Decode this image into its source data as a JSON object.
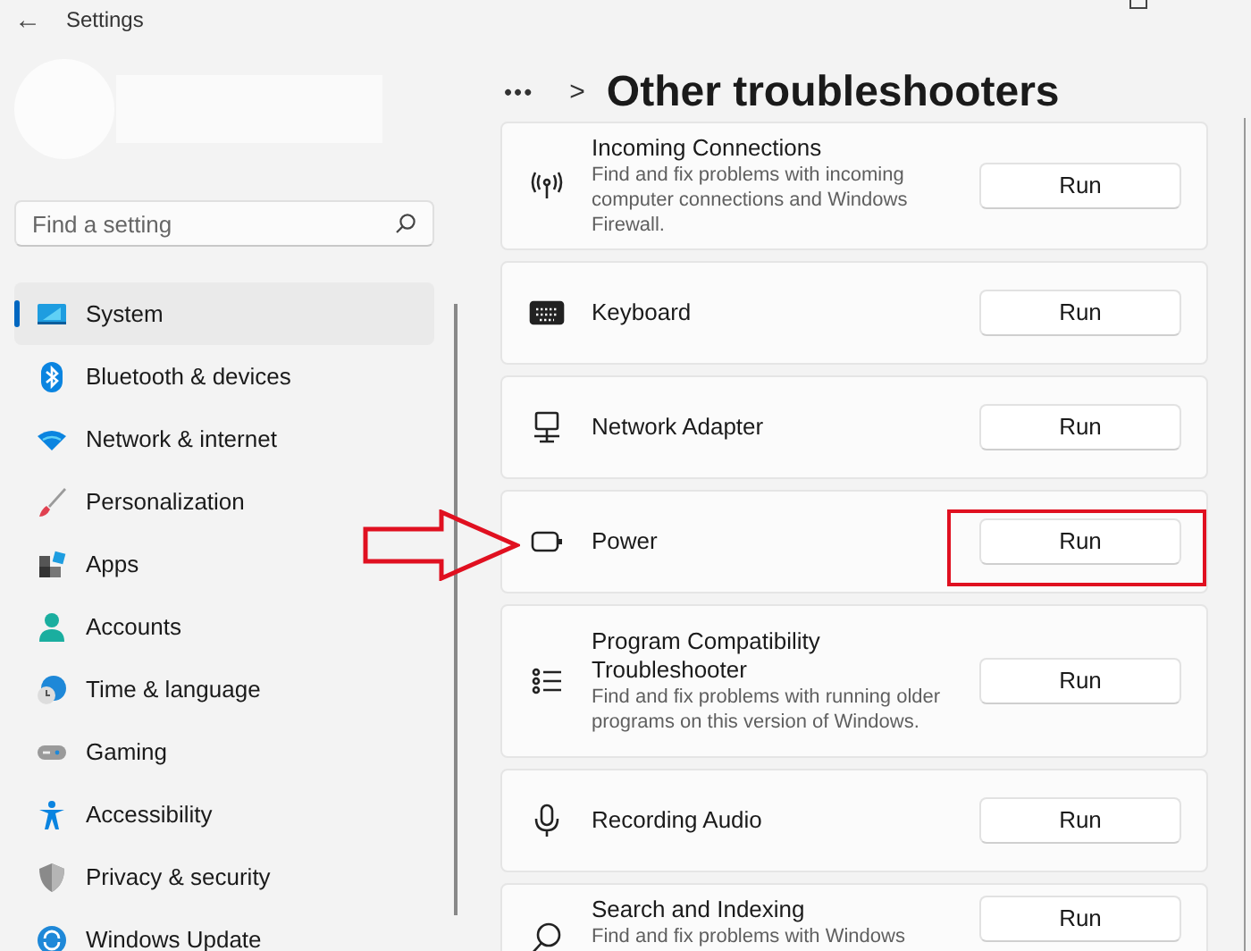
{
  "window": {
    "title": "Settings",
    "back": "←"
  },
  "sidebar": {
    "search": {
      "placeholder": "Find a setting"
    },
    "items": [
      {
        "label": "System",
        "selected": true
      },
      {
        "label": "Bluetooth & devices",
        "selected": false
      },
      {
        "label": "Network & internet",
        "selected": false
      },
      {
        "label": "Personalization",
        "selected": false
      },
      {
        "label": "Apps",
        "selected": false
      },
      {
        "label": "Accounts",
        "selected": false
      },
      {
        "label": "Time & language",
        "selected": false
      },
      {
        "label": "Gaming",
        "selected": false
      },
      {
        "label": "Accessibility",
        "selected": false
      },
      {
        "label": "Privacy & security",
        "selected": false
      },
      {
        "label": "Windows Update",
        "selected": false
      }
    ]
  },
  "header": {
    "breadcrumb_more": "•••",
    "separator": ">",
    "title": "Other troubleshooters"
  },
  "troubleshooters": [
    {
      "title": "Incoming Connections",
      "description": "Find and fix problems with incoming computer connections and Windows Firewall.",
      "button": "Run",
      "highlighted": false
    },
    {
      "title": "Keyboard",
      "button": "Run",
      "highlighted": false
    },
    {
      "title": "Network Adapter",
      "button": "Run",
      "highlighted": false
    },
    {
      "title": "Power",
      "button": "Run",
      "highlighted": true
    },
    {
      "title": "Program Compatibility Troubleshooter",
      "description": "Find and fix problems with running older programs on this version of Windows.",
      "button": "Run",
      "highlighted": false
    },
    {
      "title": "Recording Audio",
      "button": "Run",
      "highlighted": false
    },
    {
      "title": "Search and Indexing",
      "description": "Find and fix problems with Windows",
      "button": "Run",
      "highlighted": false
    }
  ]
}
